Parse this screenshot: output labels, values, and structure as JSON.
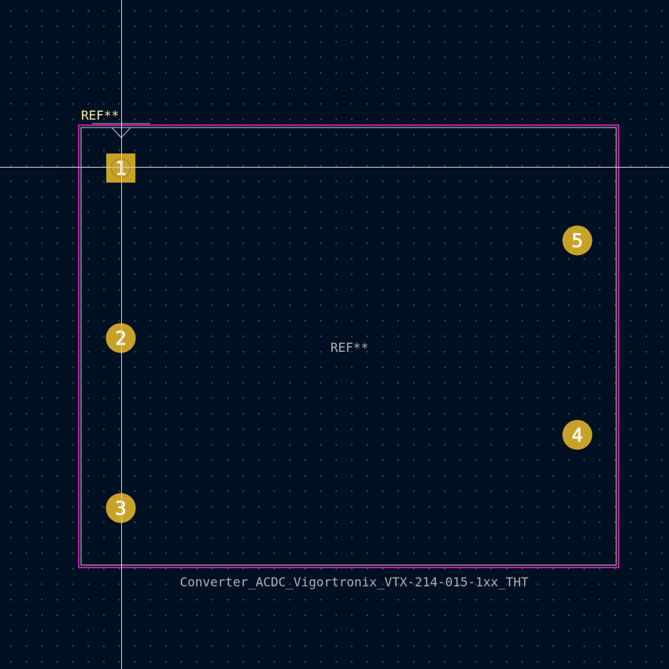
{
  "footprint": {
    "ref_silk": "REF**",
    "ref_fab": "REF**",
    "value": "Converter_ACDC_Vigortronix_VTX-214-015-1xx_THT",
    "pads": [
      {
        "number": "1",
        "shape": "square"
      },
      {
        "number": "2",
        "shape": "circle"
      },
      {
        "number": "3",
        "shape": "circle"
      },
      {
        "number": "4",
        "shape": "circle"
      },
      {
        "number": "5",
        "shape": "circle"
      }
    ]
  },
  "colors": {
    "background": "#001023",
    "grid": "#848484",
    "courtyard": "#ff26e2",
    "fab": "#afafaf",
    "silkscreen": "#f2eda1",
    "pad": "#c8a228",
    "pad_text": "#ffffff",
    "crosshair": "#cfcfcf"
  }
}
